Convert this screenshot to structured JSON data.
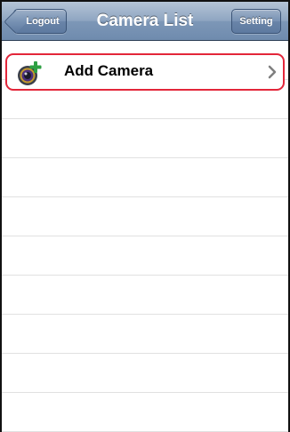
{
  "navbar": {
    "title": "Camera List",
    "left_button": "Logout",
    "right_button": "Setting"
  },
  "list": {
    "add_camera_label": "Add Camera"
  },
  "colors": {
    "highlight_border": "#e3263a",
    "navbar": "#7d97b7"
  },
  "icons": {
    "add_camera": "camera-plus-icon",
    "disclosure": "chevron-right-icon"
  }
}
